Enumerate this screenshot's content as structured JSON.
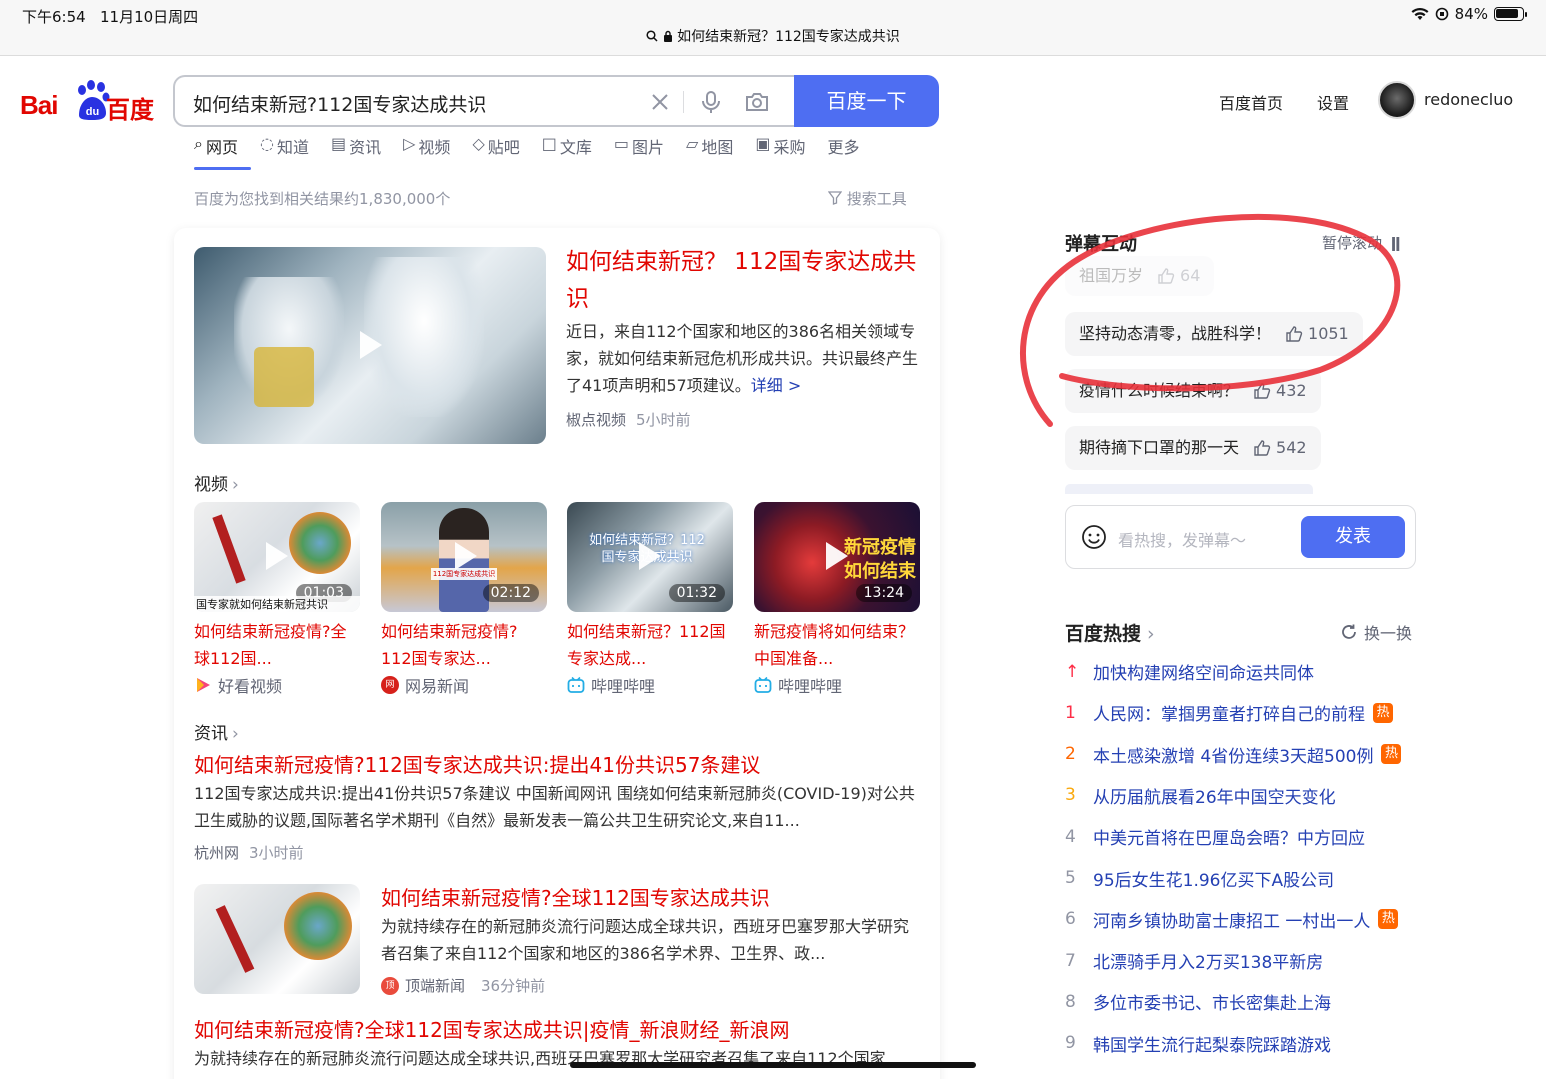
{
  "status": {
    "time": "下午6:54",
    "date": "11月10日周四",
    "battery": "84%",
    "battery_level": 0.84
  },
  "url": {
    "title": "如何结束新冠？112国专家达成共识"
  },
  "logo": {
    "latin": "Bai",
    "paw_text": "du",
    "cn": "百度"
  },
  "search": {
    "query": "如何结束新冠?112国专家达成共识",
    "button": "百度一下"
  },
  "top_links": {
    "home": "百度首页",
    "settings": "设置",
    "username": "redonecluo"
  },
  "tabs": [
    "网页",
    "知道",
    "资讯",
    "视频",
    "贴吧",
    "文库",
    "图片",
    "地图",
    "采购",
    "更多"
  ],
  "result_count": "百度为您找到相关结果约1,830,000个",
  "search_tools": "搜索工具",
  "main_result": {
    "title": "如何结束新冠？ 112国专家达成共识",
    "desc": "近日，来自112个国家和地区的386名相关领域专家，就如何结束新冠危机形成共识。共识最终产生了41项声明和57项建议。",
    "more": "详细 >",
    "source": "椒点视频",
    "age": "5小时前"
  },
  "videos_label": "视频",
  "videos": [
    {
      "title": "如何结束新冠疫情?全球112国...",
      "duration": "01:03",
      "source": "好看视频",
      "caption": "国专家就如何结束新冠共识"
    },
    {
      "title": "如何结束新冠疫情?112国专家达...",
      "duration": "02:12",
      "source": "网易新闻",
      "caption": "112国专家达成共识"
    },
    {
      "title": "如何结束新冠？112国专家达成...",
      "duration": "01:32",
      "source": "哔哩哔哩",
      "caption": "如何结束新冠？112国专家达成共识"
    },
    {
      "title": "新冠疫情将如何结束？中国准备...",
      "duration": "13:24",
      "source": "哔哩哔哩",
      "caption": "新冠疫情 如何结束"
    }
  ],
  "news_label": "资讯",
  "news": [
    {
      "title": "如何结束新冠疫情?112国专家达成共识:提出41份共识57条建议",
      "desc": "112国专家达成共识:提出41份共识57条建议 中国新闻网讯 围绕如何结束新冠肺炎(COVID-19)对公共卫生威胁的议题,国际著名学术期刊《自然》最新发表一篇公共卫生研究论文,来自11...",
      "source": "杭州网",
      "age": "3小时前"
    },
    {
      "title": "如何结束新冠疫情?全球112国专家达成共识",
      "desc": "为就持续存在的新冠肺炎流行问题达成全球共识，西班牙巴塞罗那大学研究者召集了来自112个国家和地区的386名学术界、卫生界、政...",
      "source": "顶端新闻",
      "age": "36分钟前"
    },
    {
      "title": "如何结束新冠疫情?全球112国专家达成共识|疫情_新浪财经_新浪网",
      "desc": "为就持续存在的新冠肺炎流行问题达成全球共识,西班牙巴塞罗那大学研究者召集了来自112个国家"
    }
  ],
  "danmaku": {
    "title": "弹幕互动",
    "pause": "暂停滚动",
    "items": [
      {
        "text": "祖国万岁",
        "likes": "64"
      },
      {
        "text": "坚持动态清零，战胜科学！",
        "likes": "1051"
      },
      {
        "text": "疫情什么时候结束啊？",
        "likes": "432"
      },
      {
        "text": "期待摘下口罩的那一天",
        "likes": "542"
      }
    ],
    "placeholder": "看热搜，发弹幕～",
    "send": "发表"
  },
  "hot": {
    "title": "百度热搜",
    "refresh": "换一换",
    "items": [
      {
        "rank": "↑",
        "text": "加快构建网络空间命运共同体",
        "tag": ""
      },
      {
        "rank": "1",
        "text": "人民网：掌掴男童者打碎自己的前程",
        "tag": "热"
      },
      {
        "rank": "2",
        "text": "本土感染激增 4省份连续3天超500例",
        "tag": "热"
      },
      {
        "rank": "3",
        "text": "从历届航展看26年中国空天变化",
        "tag": ""
      },
      {
        "rank": "4",
        "text": "中美元首将在巴厘岛会晤？中方回应",
        "tag": ""
      },
      {
        "rank": "5",
        "text": "95后女生花1.96亿买下A股公司",
        "tag": ""
      },
      {
        "rank": "6",
        "text": "河南乡镇协助富士康招工 一村出一人",
        "tag": "热"
      },
      {
        "rank": "7",
        "text": "北漂骑手月入2万买138平新房",
        "tag": ""
      },
      {
        "rank": "8",
        "text": "多位市委书记、市长密集赴上海",
        "tag": ""
      },
      {
        "rank": "9",
        "text": "韩国学生流行起梨泰院踩踏游戏",
        "tag": ""
      }
    ]
  },
  "colors": {
    "brand_red": "#e10601",
    "brand_blue": "#4e6ef2",
    "link_blue": "#2440b3",
    "hot_tag": "#ff6600",
    "annotation_red": "#e8313a",
    "rank1": "#fe2d46",
    "rank2": "#f60",
    "rank3": "#faa90e"
  }
}
